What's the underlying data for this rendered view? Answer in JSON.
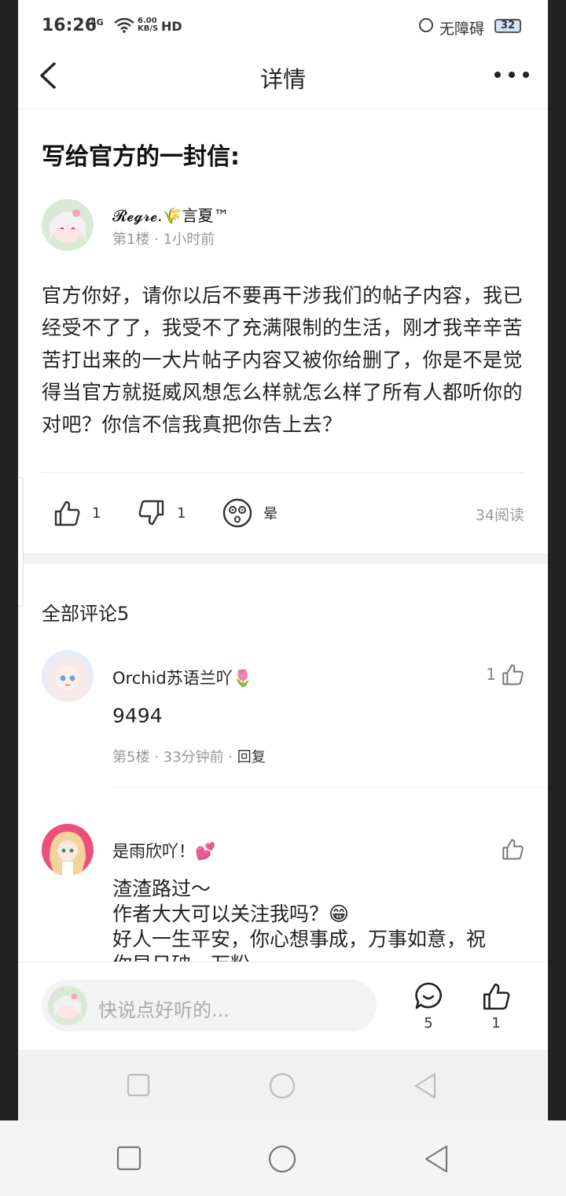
{
  "status_bar": {
    "time": "16:26",
    "signal": "4G",
    "speed_top": "6.00",
    "speed_bottom": "KB/S",
    "hd": "HD",
    "accessibility": "无障碍",
    "battery": "32"
  },
  "header": {
    "title": "详情"
  },
  "post": {
    "title": "写给官方的一封信:",
    "author": "𝓡𝓮𝓰𝓻𝓮.🌾言夏™",
    "floor": "第1楼",
    "time": "1小时前",
    "content": "官方你好，请你以后不要再干涉我们的帖子内容，我已经受不了了，我受不了充满限制的生活，刚才我辛辛苦苦打出来的一大片帖子内容又被你给删了，你是不是觉得当官方就挺威风想怎么样就怎么样了所有人都听你的对吧？你信不信我真把你告上去？",
    "likes": "1",
    "dislikes": "1",
    "reaction": "晕",
    "reads": "34阅读"
  },
  "comments_header": "全部评论5",
  "comments": [
    {
      "name": "Orchid苏语兰吖🌷",
      "text": "9494",
      "floor": "第5楼",
      "time": "33分钟前",
      "reply": "回复",
      "likes": "1"
    },
    {
      "name": "是雨欣吖！💕",
      "line1": "渣渣路过～",
      "line2": "作者大大可以关注我吗？😁",
      "line3": "好人一生平安，你心想事成，万事如意，祝",
      "line4": "你早日破一万粉"
    }
  ],
  "bottom_bar": {
    "placeholder": "快说点好听的...",
    "comment_count": "5",
    "like_count": "1"
  }
}
